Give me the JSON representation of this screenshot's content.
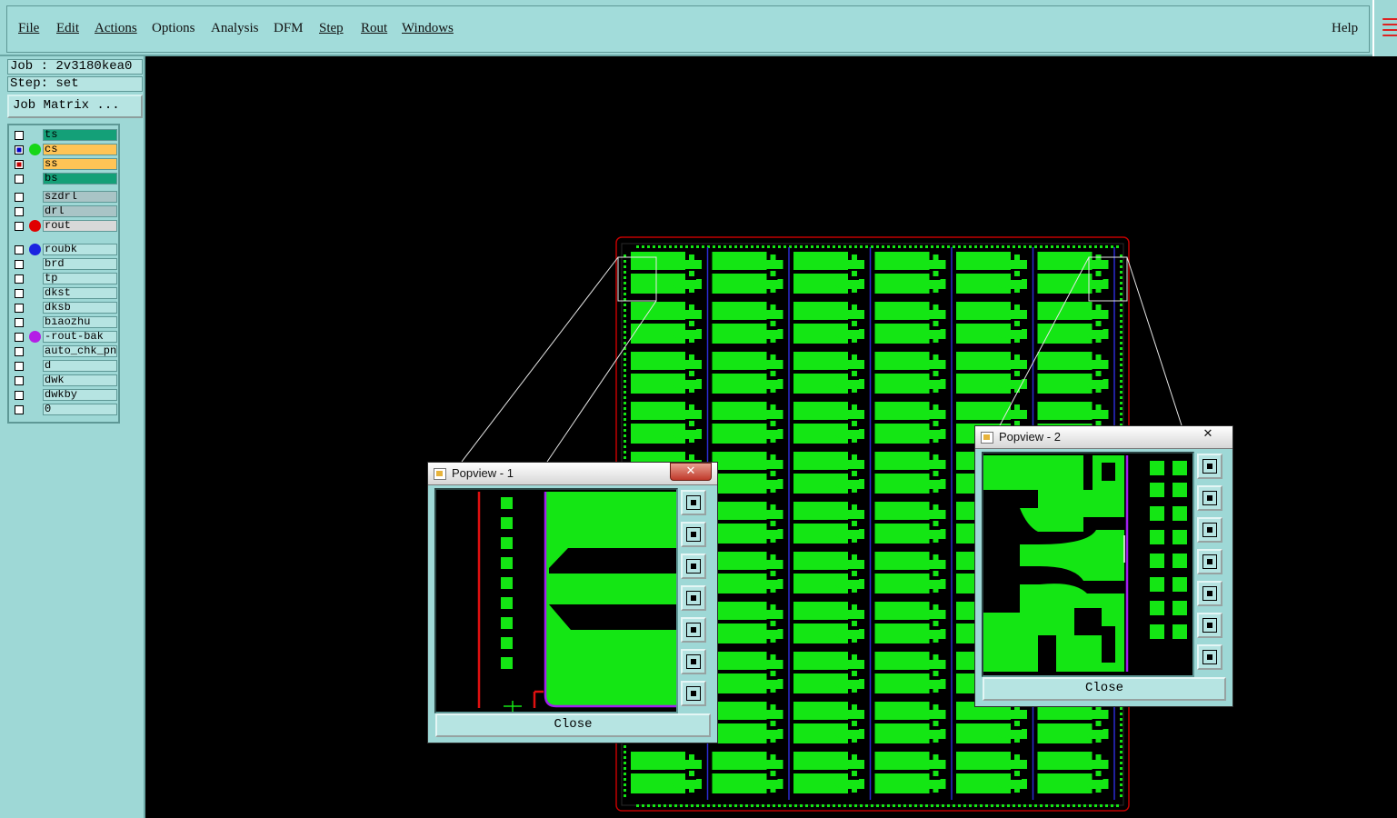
{
  "menubar": {
    "items": [
      {
        "label": "File"
      },
      {
        "label": "Edit"
      },
      {
        "label": "Actions"
      },
      {
        "label": "Options"
      },
      {
        "label": "Analysis"
      },
      {
        "label": "DFM"
      },
      {
        "label": "Step"
      },
      {
        "label": "Rout"
      },
      {
        "label": "Windows"
      }
    ],
    "help": "Help"
  },
  "job": {
    "job_label": "Job : 2v3180kea0",
    "step_label": "Step: set",
    "matrix_button": "Job Matrix ..."
  },
  "layers": [
    {
      "name": "ts",
      "color": "#14a078",
      "checkbox": "empty",
      "dot": ""
    },
    {
      "name": "cs",
      "color": "#ffc456",
      "checkbox": "blue",
      "dot": "#17d617"
    },
    {
      "name": "ss",
      "color": "#ffc456",
      "checkbox": "red",
      "dot": ""
    },
    {
      "name": "bs",
      "color": "#14a078",
      "checkbox": "empty",
      "dot": ""
    },
    {
      "name": "szdrl",
      "color": "#a9c4c6",
      "checkbox": "empty",
      "dot": ""
    },
    {
      "name": "drl",
      "color": "#a9c4c6",
      "checkbox": "empty",
      "dot": ""
    },
    {
      "name": "rout",
      "color": "#d8d8d8",
      "checkbox": "empty",
      "dot": "#e00000"
    },
    {
      "name": "roubk",
      "color": "#b6e4e2",
      "checkbox": "empty",
      "dot": "#1a23e0"
    },
    {
      "name": "brd",
      "color": "#b6e4e2",
      "checkbox": "empty",
      "dot": ""
    },
    {
      "name": "tp",
      "color": "#b6e4e2",
      "checkbox": "empty",
      "dot": ""
    },
    {
      "name": "dkst",
      "color": "#b6e4e2",
      "checkbox": "empty",
      "dot": ""
    },
    {
      "name": "dksb",
      "color": "#b6e4e2",
      "checkbox": "empty",
      "dot": ""
    },
    {
      "name": "biaozhu",
      "color": "#b6e4e2",
      "checkbox": "empty",
      "dot": ""
    },
    {
      "name": "-rout-bak",
      "color": "#b6e4e2",
      "checkbox": "empty",
      "dot": "#b41ee6"
    },
    {
      "name": "auto_chk_pn",
      "color": "#b6e4e2",
      "checkbox": "empty",
      "dot": ""
    },
    {
      "name": "d",
      "color": "#b6e4e2",
      "checkbox": "empty",
      "dot": ""
    },
    {
      "name": "dwk",
      "color": "#b6e4e2",
      "checkbox": "empty",
      "dot": ""
    },
    {
      "name": "dwkby",
      "color": "#b6e4e2",
      "checkbox": "empty",
      "dot": ""
    },
    {
      "name": "0",
      "color": "#b6e4e2",
      "checkbox": "empty",
      "dot": ""
    }
  ],
  "popview1": {
    "title": "Popview - 1",
    "close_x": "✕",
    "close_label": "Close"
  },
  "popview2": {
    "title": "Popview - 2",
    "close_x": "✕",
    "close_label": "Close"
  },
  "toolbar_icons": [
    "zoom-window-icon",
    "pan-up-icon",
    "pan-down-icon",
    "pan-left-icon",
    "pan-right-icon",
    "zoom-in-icon",
    "zoom-out-icon"
  ],
  "colors": {
    "copper": "#14e614",
    "outline": "#c00000",
    "rout_path": "#a020f0",
    "background": "#000000",
    "panel": "#9ed8d6"
  }
}
